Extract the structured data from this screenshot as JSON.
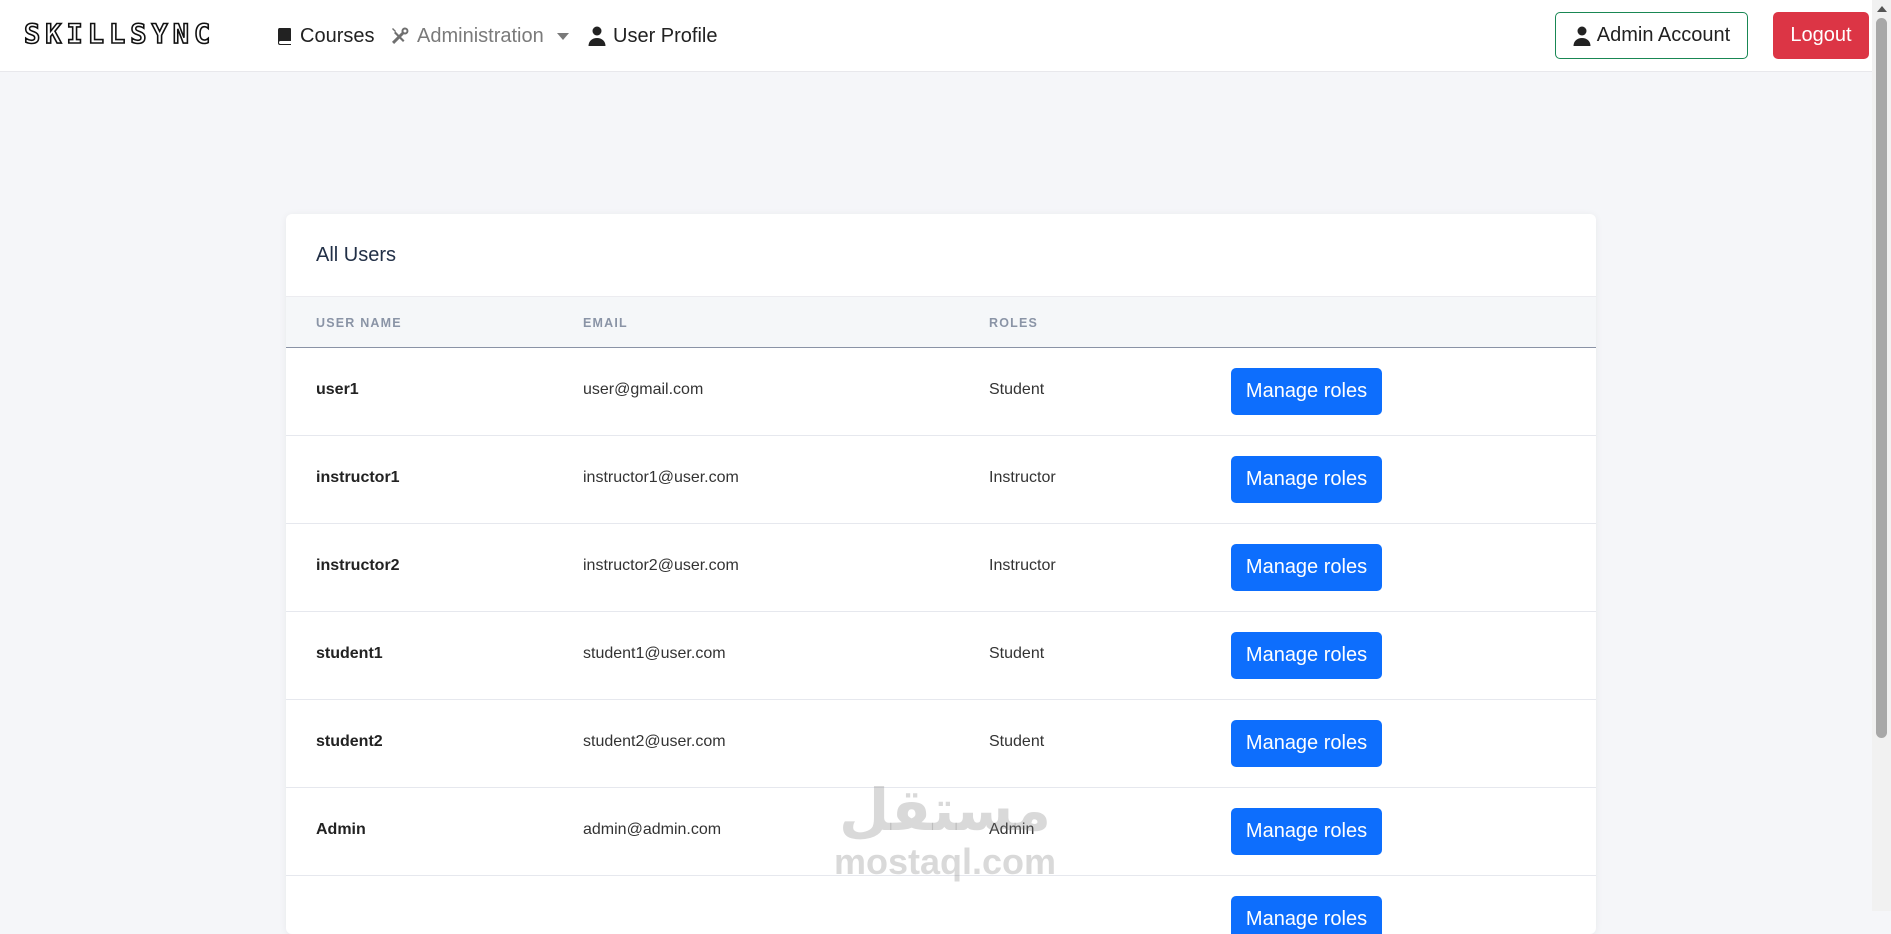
{
  "brand": "SKILLSYNC",
  "nav": {
    "courses": "Courses",
    "administration": "Administration",
    "profile": "User Profile",
    "admin_account": "Admin Account",
    "logout": "Logout"
  },
  "colors": {
    "primary": "#0d6efd",
    "danger": "#dc3545",
    "success": "#198754"
  },
  "card": {
    "title": "All Users",
    "columns": [
      "USER NAME",
      "EMAIL",
      "ROLES",
      ""
    ],
    "action_label": "Manage roles",
    "rows": [
      {
        "name": "user1",
        "email": "user@gmail.com",
        "role": "Student"
      },
      {
        "name": "instructor1",
        "email": "instructor1@user.com",
        "role": "Instructor"
      },
      {
        "name": "instructor2",
        "email": "instructor2@user.com",
        "role": "Instructor"
      },
      {
        "name": "student1",
        "email": "student1@user.com",
        "role": "Student"
      },
      {
        "name": "student2",
        "email": "student2@user.com",
        "role": "Student"
      },
      {
        "name": "Admin",
        "email": "admin@admin.com",
        "role": "Admin"
      },
      {
        "name": "",
        "email": "",
        "role": ""
      }
    ]
  },
  "watermark": {
    "arabic": "مستقل",
    "latin": "mostaql.com"
  }
}
